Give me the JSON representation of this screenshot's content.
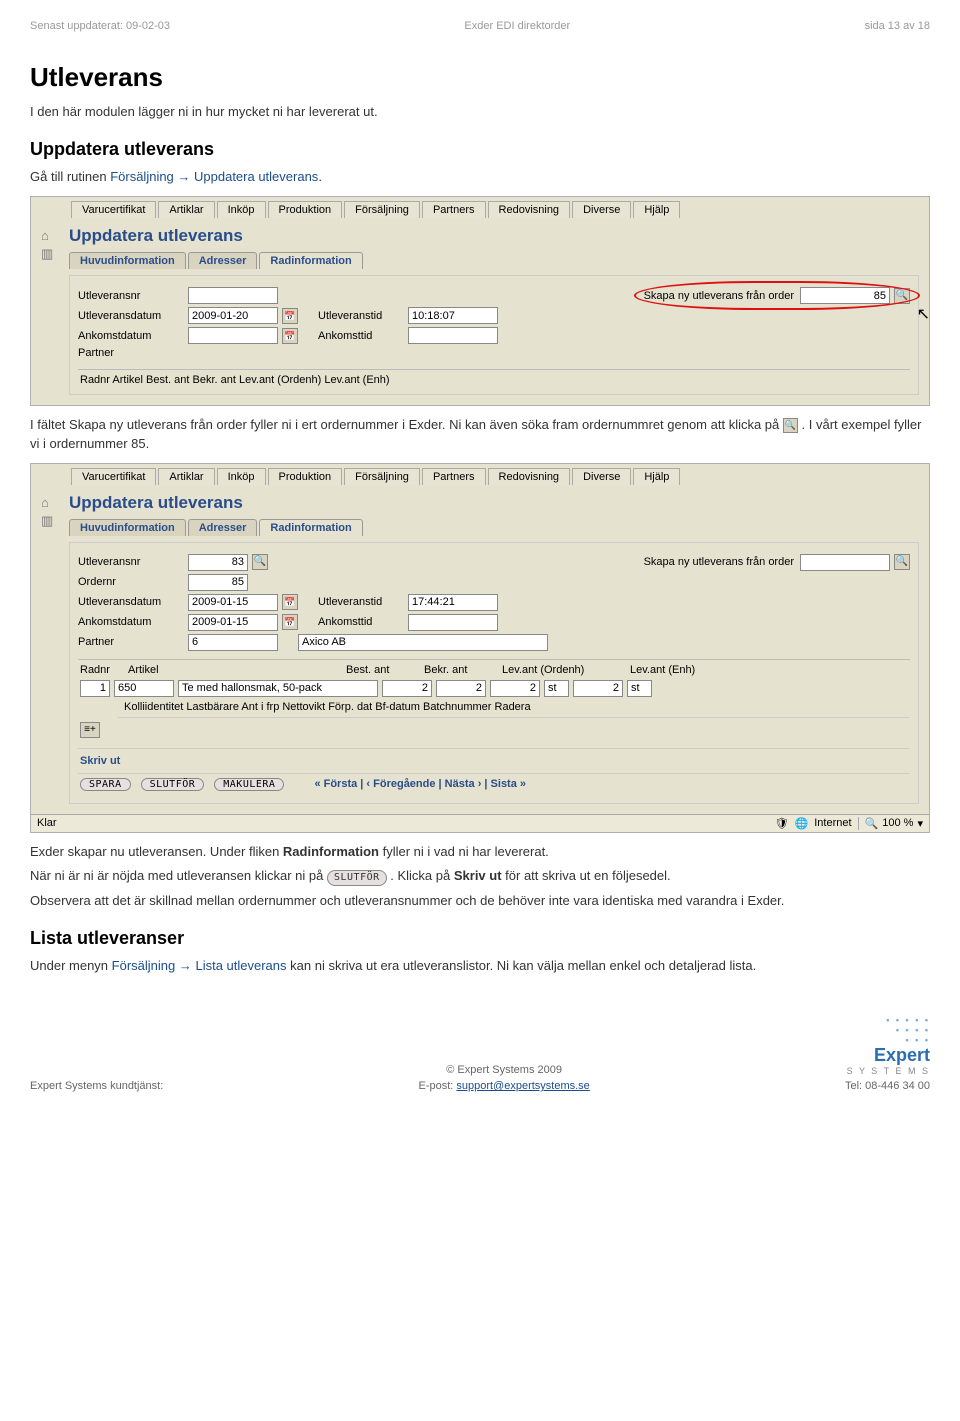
{
  "header": {
    "updated": "Senast uppdaterat: 09-02-03",
    "title": "Exder EDI direktorder",
    "page": "sida 13 av 18"
  },
  "h1": "Utleverans",
  "p_intro": "I den här modulen lägger ni in hur mycket ni har levererat ut.",
  "h2_upd": "Uppdatera utleverans",
  "p_upd_1": "Gå till rutinen ",
  "p_upd_link": "Försäljning → Uppdatera utleverans",
  "p_upd_2": ".",
  "app_menu": [
    "Varucertifikat",
    "Artiklar",
    "Inköp",
    "Produktion",
    "Försäljning",
    "Partners",
    "Redovisning",
    "Diverse",
    "Hjälp"
  ],
  "app_title": "Uppdatera utleverans",
  "subtabs": [
    "Huvudinformation",
    "Adresser",
    "Radinformation"
  ],
  "form1": {
    "utleveransnr": "Utleveransnr",
    "skapa_lbl": "Skapa ny utleverans från order",
    "skapa_val": "85",
    "utlevdatum": "Utleveransdatum",
    "utlevdatum_val": "2009-01-20",
    "utlevtid": "Utleveranstid",
    "utlevtid_val": "10:18:07",
    "ankdatum": "Ankomstdatum",
    "anktid": "Ankomsttid",
    "partner": "Partner",
    "table_hdr": "Radnr Artikel Best. ant Bekr. ant Lev.ant (Ordenh) Lev.ant (Enh)"
  },
  "p_mid_1": "I fältet Skapa ny utleverans från order fyller ni i ert ordernummer i Exder. Ni kan även söka fram ordernummret genom att klicka på ",
  "p_mid_2": ". I vårt exempel fyller vi i ordernummer 85.",
  "form2": {
    "utleveransnr_val": "83",
    "ordernr": "Ordernr",
    "ordernr_val": "85",
    "skapa_lbl": "Skapa ny utleverans från order",
    "utlevdatum_val": "2009-01-15",
    "utlevtid_val": "17:44:21",
    "ankdatum_val": "2009-01-15",
    "partner_val": "6",
    "partner_name": "Axico AB",
    "cols": [
      "Radnr",
      "Artikel",
      "",
      "Best. ant",
      "Bekr. ant",
      "Lev.ant (Ordenh)",
      "Lev.ant (Enh)"
    ],
    "row": {
      "radnr": "1",
      "artikel": "650",
      "desc": "Te med hallonsmak, 50-pack",
      "best": "2",
      "bekr": "2",
      "lev_ord": "2",
      "unit1": "st",
      "lev_enh": "2",
      "unit2": "st"
    },
    "subrow": "Kolliidentitet Lastbärare Ant i frp Nettovikt Förp. dat Bf-datum Batchnummer Radera",
    "skrivut": "Skriv ut",
    "btns": [
      "SPARA",
      "SLUTFÖR",
      "MAKULERA"
    ],
    "pager": "« Första | ‹ Föregående | Nästa › | Sista »"
  },
  "status": {
    "klar": "Klar",
    "internet": "Internet",
    "zoom": "100 %"
  },
  "p_after_1_a": "Exder skapar nu utleveransen. Under fliken ",
  "p_after_1_b": "Radinformation",
  "p_after_1_c": " fyller ni i vad ni har levererat.",
  "p_after_2_a": "När ni är ni är nöjda med utleveransen klickar ni på ",
  "p_after_2_btn": "SLUTFÖR",
  "p_after_2_b": ". Klicka på ",
  "p_after_2_bold": "Skriv ut",
  "p_after_2_c": " för att skriva ut en följesedel.",
  "p_after_3": "Observera att det är skillnad mellan ordernummer och utleveransnummer och de behöver inte vara identiska med varandra i Exder.",
  "h2_list": "Lista utleveranser",
  "p_list_1": "Under menyn ",
  "p_list_link": "Försäljning → Lista utleverans",
  "p_list_2": " kan ni skriva ut era utleveranslistor. Ni kan välja mellan enkel och detaljerad lista.",
  "footer": {
    "left": "Expert Systems kundtjänst:",
    "copyright": "© Expert Systems 2009",
    "email_lbl": "E-post: ",
    "email": "support@expertsystems.se",
    "tel": "Tel: 08-446 34 00",
    "logo_main": "Expert",
    "logo_sub": "S Y S T E M S"
  }
}
